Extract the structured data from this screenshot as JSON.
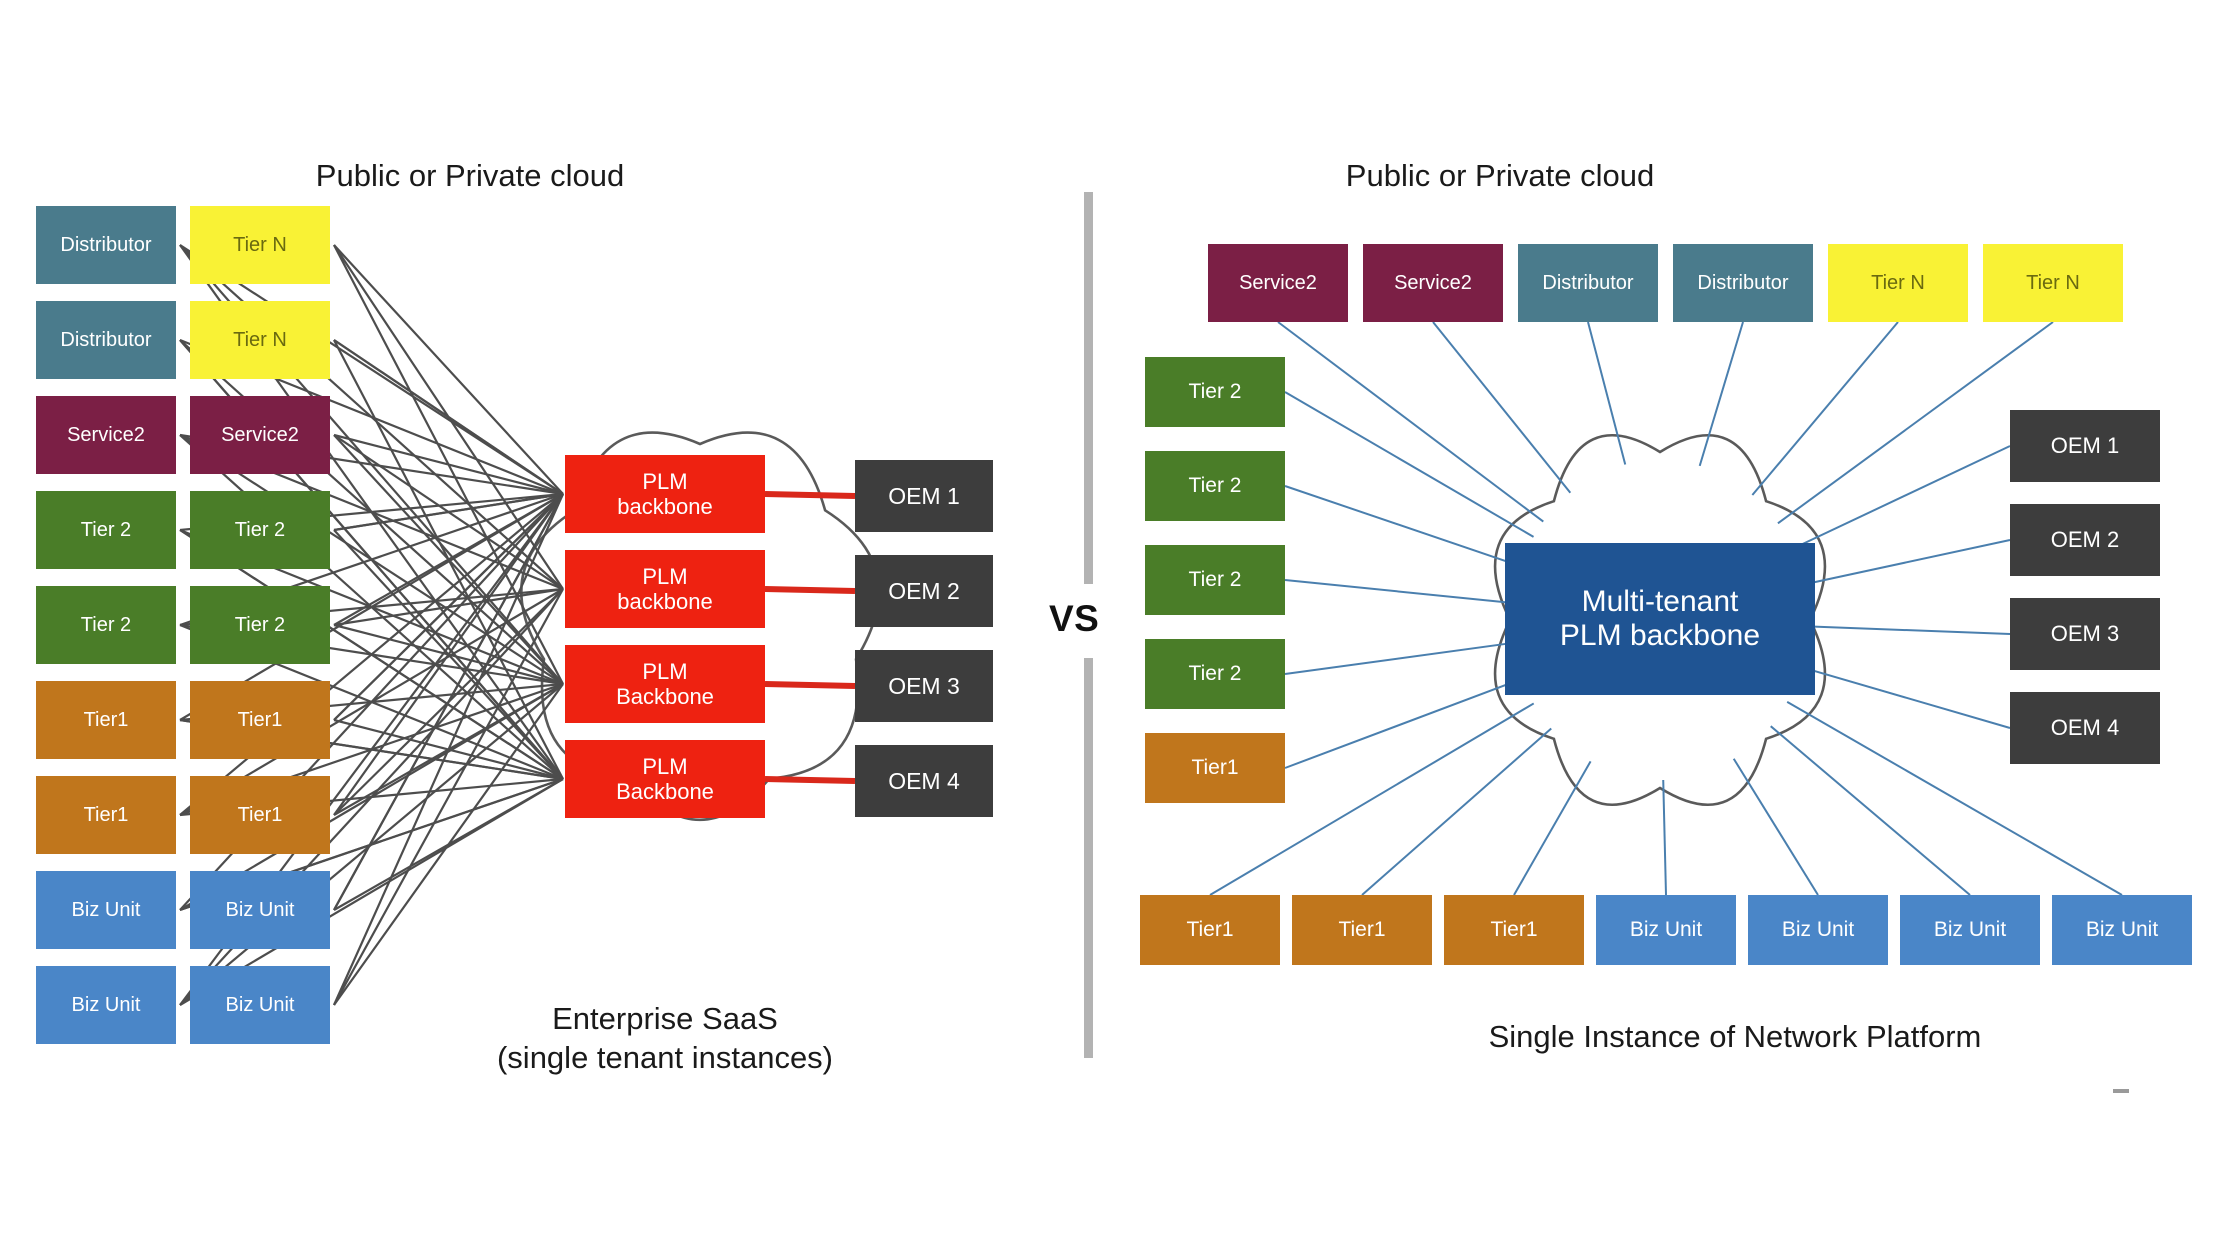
{
  "headings": {
    "left_cloud": "Public or Private cloud",
    "right_cloud": "Public or Private cloud"
  },
  "captions": {
    "left": "Enterprise  SaaS\n(single tenant instances)",
    "right": "Single Instance of Network Platform"
  },
  "vs_label": "VS",
  "colors": {
    "distributor": "#4a7b8c",
    "tier_n": "#f9f235",
    "service2": "#7b1f45",
    "tier2": "#4a7d28",
    "tier1": "#c0761c",
    "biz_unit": "#4a86c8",
    "plm_backbone": "#ee2211",
    "oem": "#3d3d3d",
    "multi_tenant": "#1f5493",
    "left_link": "#4d4d4d",
    "right_link": "#4a7fae",
    "red_link": "#d9281b",
    "cloud_stroke": "#5a5a5a",
    "divider": "#b3b3b3",
    "text_dark": "#1a1a1a"
  },
  "left_panel": {
    "tenant_columns": [
      {
        "label": "Distributor",
        "color_key": "distributor"
      },
      {
        "label": "Tier N",
        "color_key": "tier_n"
      },
      {
        "label": "Distributor",
        "color_key": "distributor"
      },
      {
        "label": "Tier N",
        "color_key": "tier_n"
      },
      {
        "label": "Service2",
        "color_key": "service2"
      },
      {
        "label": "Service2",
        "color_key": "service2"
      },
      {
        "label": "Tier 2",
        "color_key": "tier2"
      },
      {
        "label": "Tier 2",
        "color_key": "tier2"
      },
      {
        "label": "Tier 2",
        "color_key": "tier2"
      },
      {
        "label": "Tier 2",
        "color_key": "tier2"
      },
      {
        "label": "Tier1",
        "color_key": "tier1"
      },
      {
        "label": "Tier1",
        "color_key": "tier1"
      },
      {
        "label": "Tier1",
        "color_key": "tier1"
      },
      {
        "label": "Tier1",
        "color_key": "tier1"
      },
      {
        "label": "Biz Unit",
        "color_key": "biz_unit"
      },
      {
        "label": "Biz Unit",
        "color_key": "biz_unit"
      },
      {
        "label": "Biz Unit",
        "color_key": "biz_unit"
      },
      {
        "label": "Biz Unit",
        "color_key": "biz_unit"
      }
    ],
    "backbones": [
      {
        "label": "PLM\nbackbone"
      },
      {
        "label": "PLM\nbackbone"
      },
      {
        "label": "PLM\nBackbone"
      },
      {
        "label": "PLM\nBackbone"
      }
    ],
    "oems": [
      {
        "label": "OEM 1"
      },
      {
        "label": "OEM 2"
      },
      {
        "label": "OEM 3"
      },
      {
        "label": "OEM 4"
      }
    ]
  },
  "right_panel": {
    "top_row": [
      {
        "label": "Service2",
        "color_key": "service2"
      },
      {
        "label": "Service2",
        "color_key": "service2"
      },
      {
        "label": "Distributor",
        "color_key": "distributor"
      },
      {
        "label": "Distributor",
        "color_key": "distributor"
      },
      {
        "label": "Tier N",
        "color_key": "tier_n"
      },
      {
        "label": "Tier N",
        "color_key": "tier_n"
      }
    ],
    "left_col": [
      {
        "label": "Tier 2",
        "color_key": "tier2"
      },
      {
        "label": "Tier 2",
        "color_key": "tier2"
      },
      {
        "label": "Tier 2",
        "color_key": "tier2"
      },
      {
        "label": "Tier 2",
        "color_key": "tier2"
      },
      {
        "label": "Tier1",
        "color_key": "tier1"
      }
    ],
    "bottom_row": [
      {
        "label": "Tier1",
        "color_key": "tier1"
      },
      {
        "label": "Tier1",
        "color_key": "tier1"
      },
      {
        "label": "Tier1",
        "color_key": "tier1"
      },
      {
        "label": "Biz Unit",
        "color_key": "biz_unit"
      },
      {
        "label": "Biz Unit",
        "color_key": "biz_unit"
      },
      {
        "label": "Biz Unit",
        "color_key": "biz_unit"
      },
      {
        "label": "Biz Unit",
        "color_key": "biz_unit"
      }
    ],
    "oems": [
      {
        "label": "OEM 1"
      },
      {
        "label": "OEM 2"
      },
      {
        "label": "OEM 3"
      },
      {
        "label": "OEM 4"
      }
    ],
    "center": {
      "label": "Multi-tenant\nPLM backbone"
    }
  }
}
